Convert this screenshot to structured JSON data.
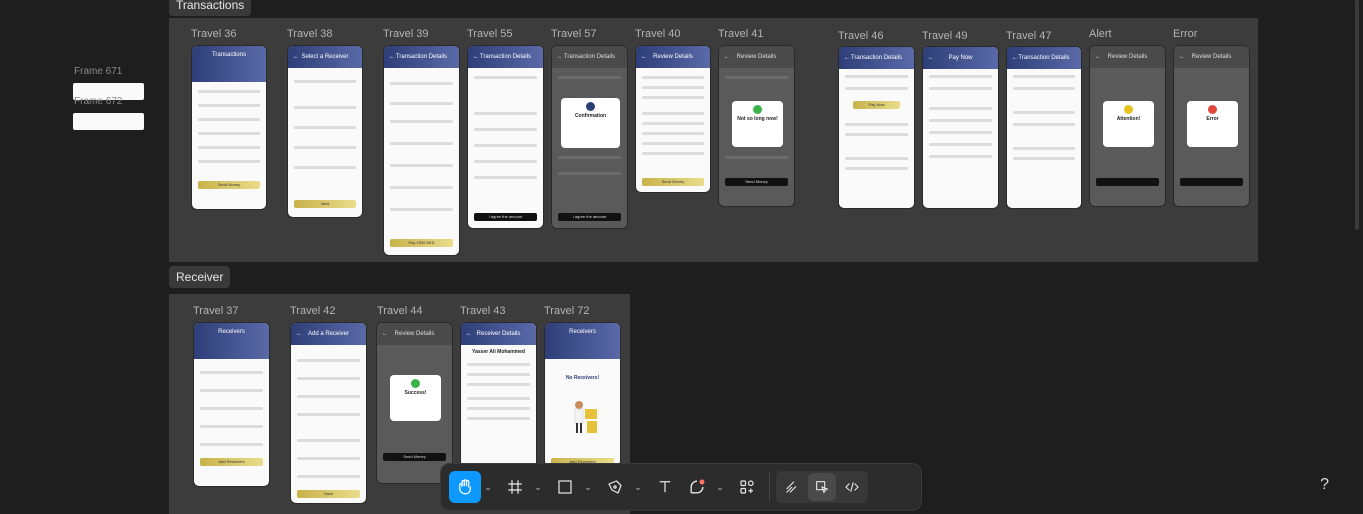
{
  "sections": {
    "transactions": {
      "label": "Transactions"
    },
    "receiver": {
      "label": "Receiver"
    }
  },
  "side_frames": [
    "Frame 671",
    "Frame 672"
  ],
  "transactions_frames": [
    {
      "title": "Travel 36",
      "header": "Transactions",
      "button": "Send Money"
    },
    {
      "title": "Travel 38",
      "header": "Select a Receiver",
      "button": "Next"
    },
    {
      "title": "Travel 39",
      "header": "Transaction Details",
      "button": "Pay 1500 AED"
    },
    {
      "title": "Travel 55",
      "header": "Transaction Details",
      "button": "I agree the amount"
    },
    {
      "title": "Travel 57",
      "header": "Transaction Details",
      "modal": "Confirmation",
      "button": "I agree the amount"
    },
    {
      "title": "Travel 40",
      "header": "Review Details",
      "button": "Send Money"
    },
    {
      "title": "Travel 41",
      "header": "Review Details",
      "modal": "Not so long now!",
      "button": "Send Money"
    },
    {
      "title": "Travel 46",
      "header": "Transaction Details",
      "button": "Pay Now"
    },
    {
      "title": "Travel 49",
      "header": "Pay Now"
    },
    {
      "title": "Travel 47",
      "header": "Transaction Details"
    },
    {
      "title": "Alert",
      "header": "Review Details",
      "modal": "Attention!"
    },
    {
      "title": "Error",
      "header": "Review Details",
      "modal": "Error"
    }
  ],
  "receiver_frames": [
    {
      "title": "Travel 37",
      "header": "Receivers",
      "button": "Add Receivers"
    },
    {
      "title": "Travel 42",
      "header": "Add a Receiver",
      "button": "Save"
    },
    {
      "title": "Travel 44",
      "header": "Review Details",
      "modal": "Success!",
      "button": "Send Money"
    },
    {
      "title": "Travel 43",
      "header": "Receiver Details",
      "name": "Yasser Ali Mohammed"
    },
    {
      "title": "Travel 72",
      "header": "Receivers",
      "empty": "No Receivers!",
      "button": "Add Receivers"
    }
  ],
  "toolbar": {
    "tools": [
      "hand-tool",
      "frame-tool",
      "rectangle-tool",
      "pen-tool",
      "text-tool",
      "shape-tool",
      "actions-tool"
    ],
    "dev_tools": [
      "draw-mode",
      "design-mode",
      "dev-mode"
    ]
  },
  "help_label": "?",
  "colors": {
    "accent": "#0d99ff",
    "header_gradient_start": "#2e3e78",
    "button_gold": "#c8b24a"
  }
}
